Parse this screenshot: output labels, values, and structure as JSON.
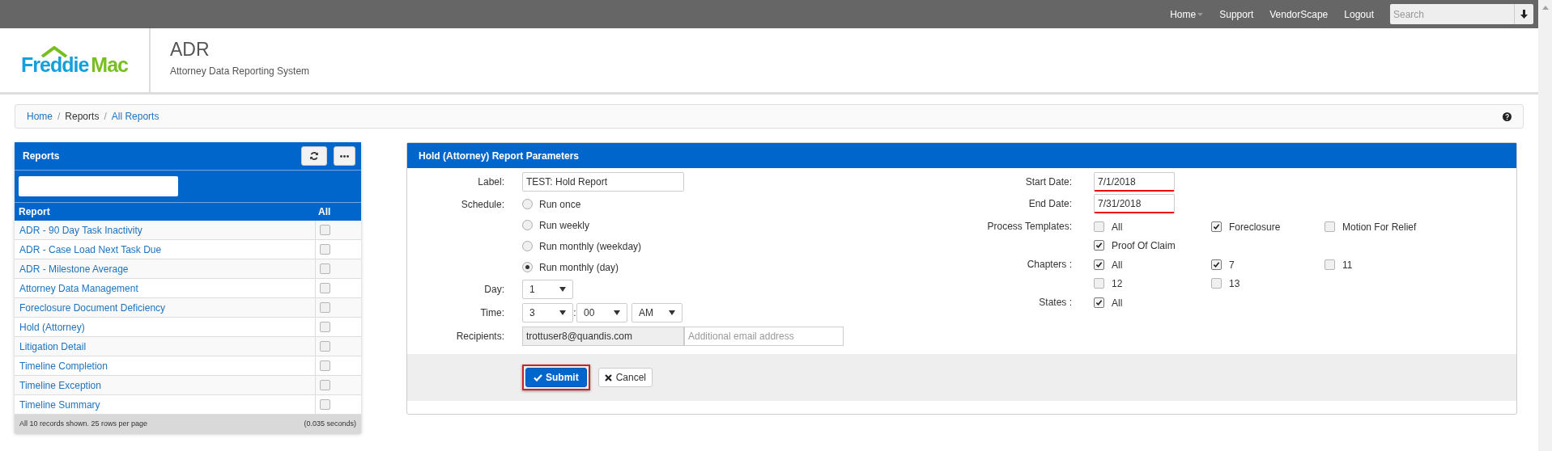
{
  "top_nav": {
    "items": [
      {
        "label": "Home",
        "dropdown": true
      },
      {
        "label": "Support",
        "dropdown": false
      },
      {
        "label": "VendorScape",
        "dropdown": false
      },
      {
        "label": "Logout",
        "dropdown": false
      }
    ],
    "search": {
      "placeholder": "Search"
    }
  },
  "header": {
    "logo": [
      "Freddie",
      "Mac"
    ],
    "title": "ADR",
    "subtitle": "Attorney Data Reporting System"
  },
  "breadcrumb": {
    "separator": "/",
    "items": [
      {
        "label": "Home",
        "kind": "link"
      },
      {
        "label": "Reports",
        "kind": "text"
      },
      {
        "label": "All Reports",
        "kind": "link"
      }
    ]
  },
  "reports_panel": {
    "title": "Reports",
    "columns": [
      "Report",
      "All"
    ],
    "rows": [
      {
        "name": "ADR - 90 Day Task Inactivity",
        "checked": false
      },
      {
        "name": "ADR - Case Load Next Task Due",
        "checked": false
      },
      {
        "name": "ADR - Milestone Average",
        "checked": false
      },
      {
        "name": "Attorney Data Management",
        "checked": false
      },
      {
        "name": "Foreclosure Document Deficiency",
        "checked": false
      },
      {
        "name": "Hold (Attorney)",
        "checked": false
      },
      {
        "name": "Litigation Detail",
        "checked": false
      },
      {
        "name": "Timeline Completion",
        "checked": false
      },
      {
        "name": "Timeline Exception",
        "checked": false
      },
      {
        "name": "Timeline Summary",
        "checked": false
      }
    ],
    "footer_left": "All 10 records shown. 25 rows per page",
    "footer_right": "(0.035 seconds)"
  },
  "form": {
    "title": "Hold (Attorney) Report Parameters",
    "label": {
      "label": "Label:",
      "value": "TEST: Hold Report"
    },
    "schedule": {
      "label": "Schedule:",
      "options": [
        {
          "label": "Run once",
          "selected": false
        },
        {
          "label": "Run weekly",
          "selected": false
        },
        {
          "label": "Run monthly (weekday)",
          "selected": false
        },
        {
          "label": "Run monthly (day)",
          "selected": true
        }
      ]
    },
    "day": {
      "label": "Day:",
      "value": "1"
    },
    "time": {
      "label": "Time:",
      "hour": "3",
      "separator": ":",
      "minute": "00",
      "period": "AM"
    },
    "recipients": {
      "label": "Recipients:",
      "value": "trottuser8@quandis.com",
      "placeholder": "Additional email address"
    },
    "start_date": {
      "label": "Start Date:",
      "value": "7/1/2018",
      "invalid": true
    },
    "end_date": {
      "label": "End Date:",
      "value": "7/31/2018",
      "invalid": true
    },
    "process_templates": {
      "label": "Process Templates:",
      "options": [
        {
          "label": "All",
          "checked": false
        },
        {
          "label": "Foreclosure",
          "checked": true
        },
        {
          "label": "Motion For Relief",
          "checked": false
        },
        {
          "label": "Proof Of Claim",
          "checked": true
        }
      ]
    },
    "chapters": {
      "label": "Chapters :",
      "options": [
        {
          "label": "All",
          "checked": true
        },
        {
          "label": "7",
          "checked": true
        },
        {
          "label": "11",
          "checked": false
        },
        {
          "label": "12",
          "checked": false
        },
        {
          "label": "13",
          "checked": false
        }
      ]
    },
    "states": {
      "label": "States :",
      "options": [
        {
          "label": "All",
          "checked": true
        }
      ]
    },
    "buttons": [
      {
        "label": "Submit",
        "kind": "primary",
        "highlighted": true
      },
      {
        "label": "Cancel",
        "kind": "default",
        "highlighted": false
      }
    ]
  }
}
